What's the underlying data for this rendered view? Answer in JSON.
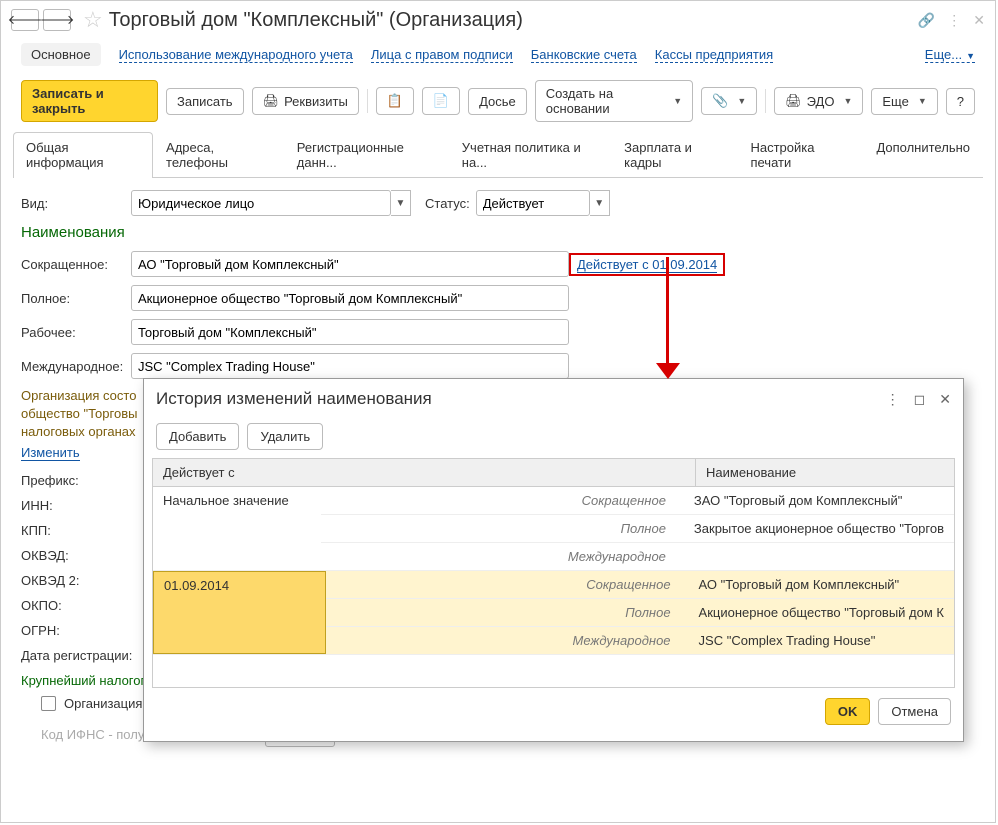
{
  "title": "Торговый дом \"Комплексный\" (Организация)",
  "header_links": {
    "main": "Основное",
    "intl": "Использование международного учета",
    "signers": "Лица с правом подписи",
    "banks": "Банковские счета",
    "cash": "Кассы предприятия",
    "more": "Еще..."
  },
  "toolbar": {
    "save_close": "Записать и закрыть",
    "save": "Записать",
    "details": "Реквизиты",
    "dossier": "Досье",
    "create_based": "Создать на основании",
    "edo": "ЭДО",
    "more": "Еще",
    "help": "?"
  },
  "tabs": [
    "Общая информация",
    "Адреса, телефоны",
    "Регистрационные данн...",
    "Учетная политика и на...",
    "Зарплата и кадры",
    "Настройка печати",
    "Дополнительно"
  ],
  "form": {
    "kind_lbl": "Вид:",
    "kind_val": "Юридическое лицо",
    "status_lbl": "Статус:",
    "status_val": "Действует",
    "names_head": "Наименования",
    "short_lbl": "Сокращенное:",
    "short_val": "АО \"Торговый дом Комплексный\"",
    "hist_link": "Действует с 01.09.2014",
    "full_lbl": "Полное:",
    "full_val": "Акционерное общество \"Торговый дом Комплексный\"",
    "work_lbl": "Рабочее:",
    "work_val": "Торговый дом \"Комплексный\"",
    "intl_lbl": "Международное:",
    "intl_val": "JSC \"Complex Trading House\"",
    "org_desc": "Организация состо",
    "org_desc2": "общество \"Торговы",
    "org_desc3": "налоговых органах",
    "change": "Изменить",
    "prefix": "Префикс:",
    "inn": "ИНН:",
    "kpp": "КПП:",
    "okved": "ОКВЭД:",
    "okved2": "ОКВЭД 2:",
    "okpo": "ОКПО:",
    "ogrn": "ОГРН:",
    "regdate": "Дата регистрации:",
    "largest": "Крупнейший налогоплательщик:",
    "largest_chk": "Организация является крупнейшим налогоплательщиком",
    "ifns": "Код ИФНС - получателя отчетности:",
    "help": "?"
  },
  "dialog": {
    "title": "История изменений наименования",
    "add": "Добавить",
    "del": "Удалить",
    "col1": "Действует с",
    "col2": "Наименование",
    "rows": [
      {
        "date": "Начальное значение",
        "short_lbl": "Сокращенное",
        "short_val": "ЗАО \"Торговый дом Комплексный\"",
        "full_lbl": "Полное",
        "full_val": "Закрытое акционерное общество \"Торгов",
        "intl_lbl": "Международное",
        "intl_val": ""
      },
      {
        "date": "01.09.2014",
        "short_lbl": "Сокращенное",
        "short_val": "АО \"Торговый дом Комплексный\"",
        "full_lbl": "Полное",
        "full_val": "Акционерное общество \"Торговый дом К",
        "intl_lbl": "Международное",
        "intl_val": "JSC \"Complex Trading House\""
      }
    ],
    "ok": "OK",
    "cancel": "Отмена"
  }
}
